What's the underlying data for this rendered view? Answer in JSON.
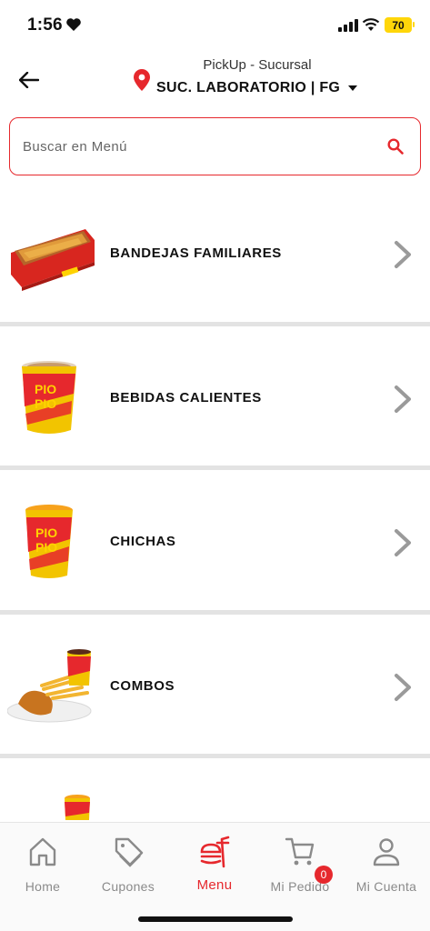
{
  "status_bar": {
    "time": "1:56",
    "battery": "70"
  },
  "header": {
    "mode": "PickUp - Sucursal",
    "branch": "SUC. LABORATORIO | FG"
  },
  "search": {
    "placeholder": "Buscar en Menú"
  },
  "categories": [
    {
      "label": "BANDEJAS FAMILIARES",
      "icon": "tray-image"
    },
    {
      "label": "BEBIDAS CALIENTES",
      "icon": "hot-drink-image"
    },
    {
      "label": "CHICHAS",
      "icon": "chicha-cup-image"
    },
    {
      "label": "COMBOS",
      "icon": "combo-image"
    },
    {
      "label": "",
      "icon": "cup-image"
    }
  ],
  "bottom_nav": [
    {
      "label": "Home",
      "icon": "home-icon"
    },
    {
      "label": "Cupones",
      "icon": "tag-icon"
    },
    {
      "label": "Menu",
      "icon": "menu-icon",
      "active": true
    },
    {
      "label": "Mi Pedido",
      "icon": "cart-icon",
      "badge": "0"
    },
    {
      "label": "Mi Cuenta",
      "icon": "user-icon"
    }
  ],
  "colors": {
    "accent": "#e6282d",
    "divider": "#e3e3e3",
    "inactive": "#8a8a8a"
  }
}
